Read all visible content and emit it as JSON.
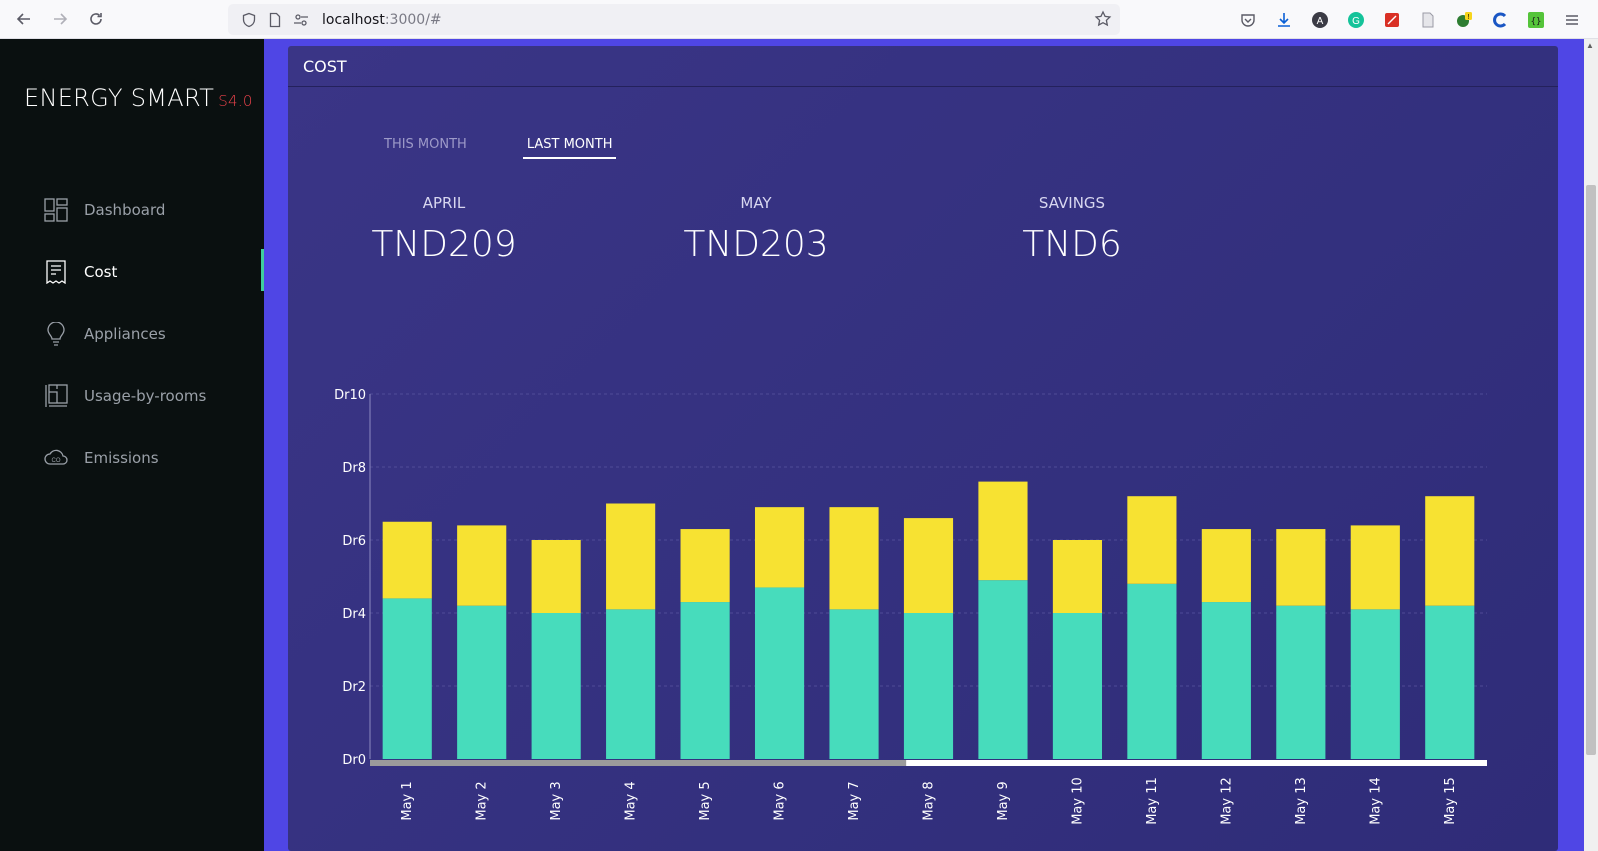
{
  "browser": {
    "url_host": "localhost",
    "url_path": ":3000/#"
  },
  "brand": {
    "name": "ENERGY SMART",
    "version": "S4.0"
  },
  "sidebar": {
    "items": [
      {
        "label": "Dashboard",
        "icon": "dashboard-icon",
        "active": false
      },
      {
        "label": "Cost",
        "icon": "receipt-icon",
        "active": true
      },
      {
        "label": "Appliances",
        "icon": "lightbulb-icon",
        "active": false
      },
      {
        "label": "Usage-by-rooms",
        "icon": "floorplan-icon",
        "active": false
      },
      {
        "label": "Emissions",
        "icon": "co2-cloud-icon",
        "active": false
      }
    ]
  },
  "card": {
    "title": "COST",
    "tabs": [
      {
        "label": "THIS MONTH",
        "active": false
      },
      {
        "label": "LAST MONTH",
        "active": true
      }
    ],
    "stats": [
      {
        "label": "APRIL",
        "value": "TND209"
      },
      {
        "label": "MAY",
        "value": "TND203"
      },
      {
        "label": "SAVINGS",
        "value": "TND6"
      }
    ]
  },
  "colors": {
    "accent": "#4f46e5",
    "card_bg": "#34307e",
    "sidebar_bg": "#0a1010",
    "active_marker": "#3fcf9e",
    "series_bottom": "#47dcbc",
    "series_top": "#f7e232",
    "brand_version": "#e8424a"
  },
  "chart_data": {
    "type": "bar",
    "stacked": true,
    "categories": [
      "May 1",
      "May 2",
      "May 3",
      "May 4",
      "May 5",
      "May 6",
      "May 7",
      "May 8",
      "May 9",
      "May 10",
      "May 11",
      "May 12",
      "May 13",
      "May 14",
      "May 15"
    ],
    "series": [
      {
        "values": [
          4.4,
          4.2,
          4.0,
          4.1,
          4.3,
          4.7,
          4.1,
          4.0,
          4.9,
          4.0,
          4.8,
          4.3,
          4.2,
          4.1,
          4.2
        ],
        "color": "#47dcbc"
      },
      {
        "values": [
          2.1,
          2.2,
          2.0,
          2.9,
          2.0,
          2.2,
          2.8,
          2.6,
          2.7,
          2.0,
          2.4,
          2.0,
          2.1,
          2.3,
          3.0
        ],
        "color": "#f7e232"
      }
    ],
    "yticks": [
      "Dr0",
      "Dr2",
      "Dr4",
      "Dr6",
      "Dr8",
      "Dr10"
    ],
    "ylim": [
      0,
      10
    ],
    "grid": true,
    "scroll_progress": 0.48
  }
}
